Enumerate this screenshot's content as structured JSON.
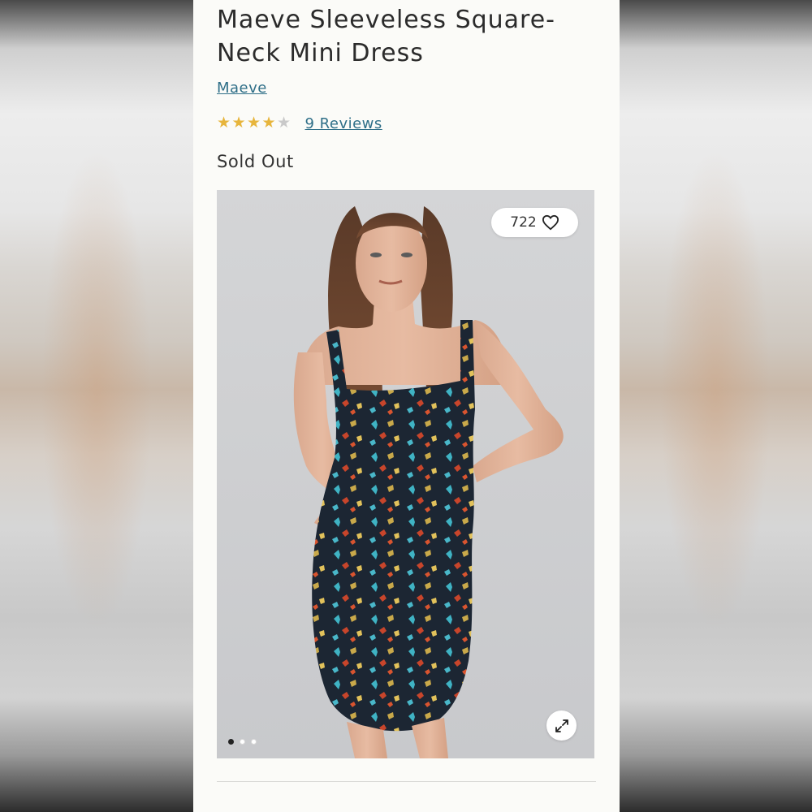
{
  "product": {
    "title": "Maeve Sleeveless Square-Neck Mini Dress",
    "brand": "Maeve",
    "rating_value": 4,
    "rating_max": 5,
    "reviews_label": "9 Reviews",
    "status": "Sold Out"
  },
  "gallery": {
    "like_count": "722",
    "image_count": 3,
    "active_index": 0,
    "icons": {
      "like": "heart-icon",
      "expand": "expand-icon"
    }
  },
  "colors": {
    "link": "#2f6f88",
    "star_filled": "#e7b53c",
    "star_empty": "#c9c9c9",
    "panel_background": "#fbfbf8"
  }
}
